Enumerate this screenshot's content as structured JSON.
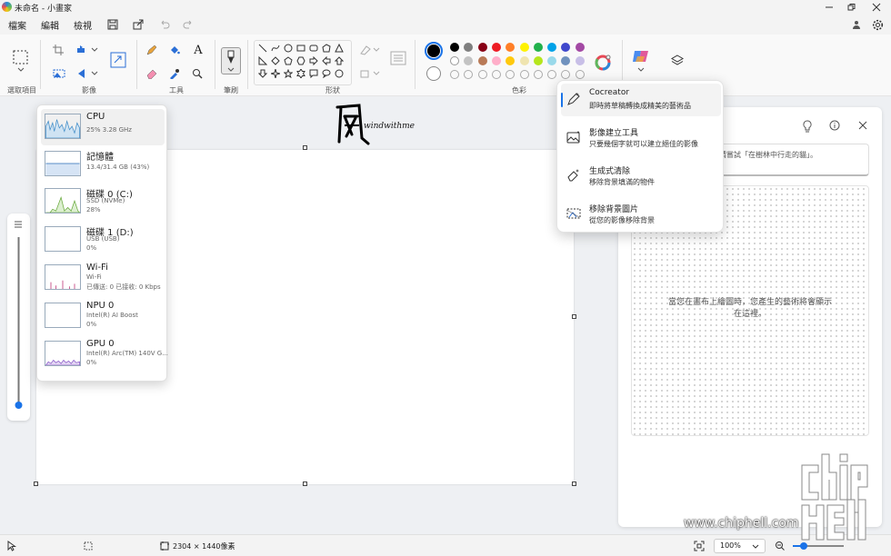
{
  "titlebar": {
    "title": "未命名 - 小畫家"
  },
  "menu": {
    "file": "檔案",
    "edit": "編輯",
    "view": "檢視"
  },
  "ribbon": {
    "groups": {
      "selection": "選取項目",
      "image": "影像",
      "tools": "工具",
      "brush": "筆刷",
      "shapes": "形狀",
      "colors": "色彩"
    },
    "tool_text_glyph": "A",
    "colors_row1": [
      "#000000",
      "#7f7f7f",
      "#880015",
      "#ed1c24",
      "#ff7f27",
      "#fff200",
      "#22b14c",
      "#00a2e8",
      "#3f48cc",
      "#a349a4"
    ],
    "colors_row2": [
      "#ffffff",
      "#c3c3c3",
      "#b97a57",
      "#ffaec9",
      "#ffc90e",
      "#efe4b0",
      "#b5e61d",
      "#99d9ea",
      "#7092be",
      "#c8bfe7"
    ],
    "accent": "#1a73e8"
  },
  "canvas": {
    "signature_text": "windwithme"
  },
  "taskmgr": {
    "rows": [
      {
        "name": "CPU",
        "sub": "25% 3.28 GHz"
      },
      {
        "name": "記憶體",
        "sub": "13.4/31.4 GB (43%)"
      },
      {
        "name": "磁碟 0 (C:)",
        "sub1": "SSD (NVMe)",
        "sub2": "28%"
      },
      {
        "name": "磁碟 1 (D:)",
        "sub1": "USB (USB)",
        "sub2": "0%"
      },
      {
        "name": "Wi-Fi",
        "sub1": "Wi-Fi",
        "sub2": "已傳送: 0 已接收: 0 Kbps"
      },
      {
        "name": "NPU 0",
        "sub1": "Intel(R) AI Boost",
        "sub2": "0%"
      },
      {
        "name": "GPU 0",
        "sub1": "Intel(R) Arc(TM) 140V G...",
        "sub2": "0%"
      }
    ]
  },
  "cocreator": {
    "items": [
      {
        "title": "Cocreator",
        "desc": "即時將草稿轉換成精美的藝術品"
      },
      {
        "title": "影像建立工具",
        "desc": "只要幾個字就可以建立絕佳的影像"
      },
      {
        "title": "生成式清除",
        "desc": "移除背景填滿的物件"
      },
      {
        "title": "移除背景圖片",
        "desc": "從您的影像移除背景"
      }
    ]
  },
  "side_panel": {
    "prompt_placeholder": "請嘗試「在樹林中行走的貓」。",
    "empty_line1": "當您在畫布上繪圖時，您產生的藝術將會顯示",
    "empty_line2": "在這裡。"
  },
  "status": {
    "dimensions": "2304 × 1440像素",
    "zoom": "100%"
  },
  "watermark": {
    "site": "www.chiphell.com"
  }
}
